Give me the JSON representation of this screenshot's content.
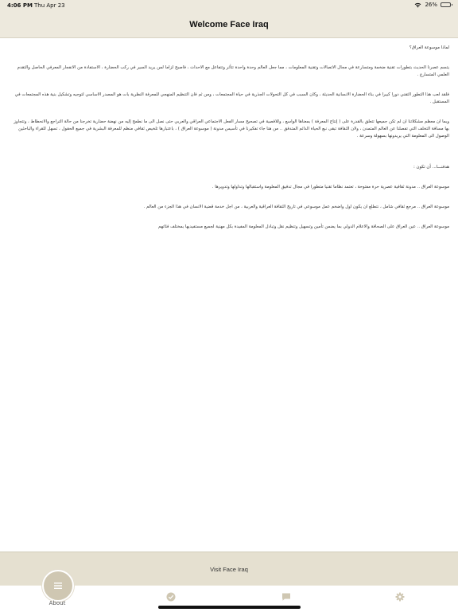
{
  "status_bar": {
    "time": "4:06 PM",
    "date": "Thu Apr 23",
    "battery": "26%",
    "battery_level": 0.26
  },
  "nav": {
    "title": "Welcome Face Iraq"
  },
  "article": {
    "paragraphs": [
      "لماذا موسوعة العراق؟",
      "يتسم عصرنا الحديث بتطورات تقنية ضخمة ومتسارعة في مجال الاتصالات وتقنية المعلومات ، مما جعل العالم وحدة واحدة تتأثر وتتفاعل مع الاحداث ، فاصبح لزاما لمن يريد السير في ركب الحضارة ، الاستفادة من الانفجار المعرفي الحاصل والتقدم العلمي المتسارع .",
      "فلقد لعب هذا التطور التقني دورا كبيرا في بناء الحضارة الانسانية الحديثة ، وكان السبب في كل التحولات الجذرية في حياة المجتمعات ، ومن ثم فان التنظيم المنهجي للمعرفة النظرية بات هو المصدر الاساسي لتوجيه وتشكيل بنية هذه المجتمعات في المستقبل .",
      "وبما ان معظم مشكلاتنا ان لم تكن جميعها تتعلق بالقدرة على ( إنتاج المعرفة ) بمعناها الواسع ، وللافصية في تصحيح مسار الفعل الاجتماعي العراقي والعربي حتى نصل الى ما نطمح إليه من نهضة حضارية تخرجنا من حالة التراجع والانحطاط ، وتتجاوز بها مسافة التخلف التي تفصلنا عن العالم المتمدن ، ولان الثقافة تبقى نبع الحياة الدائم المتدفق .. من هنا جاء تفكيرنا في تأسيس مدونة ( موسوعة العراق ) ، باعتبارها تلخيص ثقافي منظم للمعرفة البشرية في جميع الحقول ، تسهل للقراء والباحثين الوصول الى المعلومة التي يريدونها بسهولة وسرعة .",
      "هدفنـــا... أن تكون :",
      "موسوعة العراق .. مدونة ثقافية عصرية حرة مفتوحة ، تعتمد نظاما تقنيا متطورا في مجال تدفيق المعلومة واستقبالها وتداولها وتدويرها .",
      "موسوعة العراق .. مرجع ثقافي شامل ، نتطلع ان يكون اول واضخم عمل موسوعي في تاريخ الثقافة العراقية والعربية ، من اجل خدمة قضية الانسان في هذا الجزء من العالم .",
      "موسوعة العراق .. عين العراق على الصحافة والاعلام الدولي بما يضمن تأمين وتسهيل وتنظيم نقل وتبادل المعلومة المفيدة بكل مهنية لجميع مستفيديها بمختلف فئاتهم"
    ]
  },
  "visit_bar": {
    "label": "Visit Face Iraq"
  },
  "tabs": {
    "about_label": "About",
    "icons": [
      "menu-icon",
      "check-circle-icon",
      "chat-bubble-icon",
      "gear-icon"
    ]
  },
  "colors": {
    "header_bg": "#ede9dd",
    "visit_bg": "#e5e0d0",
    "accent": "#cfc7b2",
    "tab_icon": "#cfc7b2"
  }
}
